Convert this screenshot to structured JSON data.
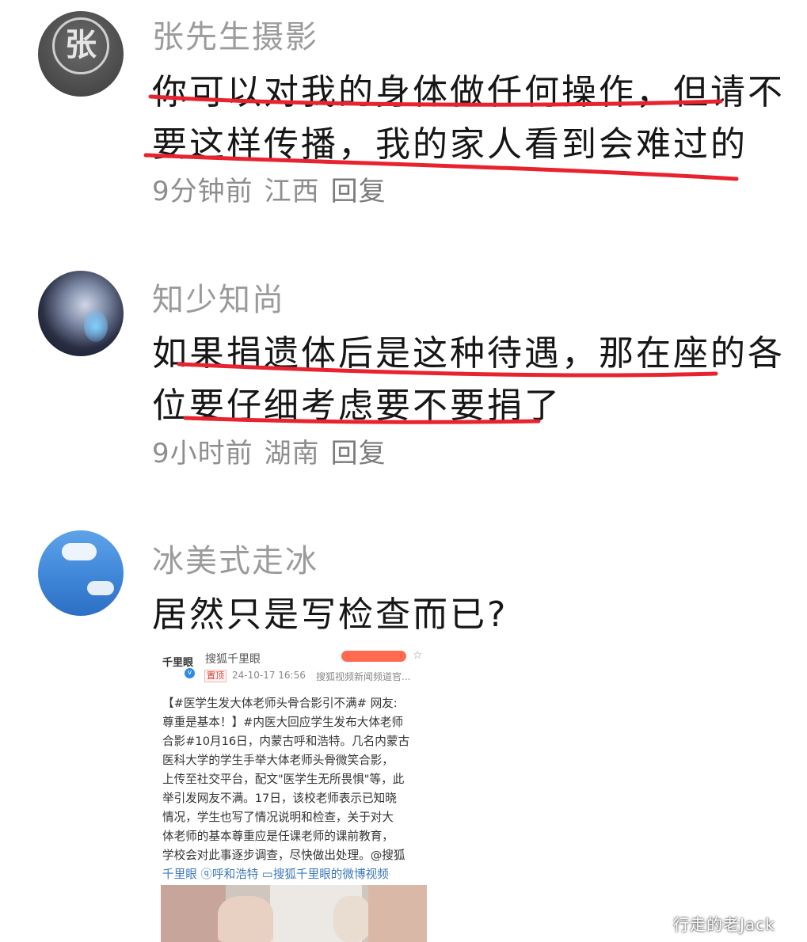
{
  "comments": [
    {
      "username": "张先生摄影",
      "avatar_text": "张",
      "lines": [
        "你可以对我的身体做任何操作，但请不",
        "要这样传播，我的家人看到会难过的"
      ],
      "time": "9分钟前",
      "location": "江西",
      "reply_label": "回复"
    },
    {
      "username": "知少知尚",
      "lines": [
        "如果捐遗体后是这种待遇，那在座的各",
        "位要仔细考虑要不要捐了"
      ],
      "time": "9小时前",
      "location": "湖南",
      "reply_label": "回复"
    },
    {
      "username": "冰美式走冰",
      "lines": [
        "居然只是写检查而已?"
      ]
    }
  ],
  "embed": {
    "logo": "千里眼",
    "source": "搜狐千里眼",
    "tag": "置顶",
    "date": "24-10-17 16:56",
    "origin": "搜狐视频新闻频道官...",
    "body_lines": [
      "【#医学生发大体老师头骨合影引不满# 网友:",
      "尊重是基本！】#内医大回应学生发布大体老师",
      "合影#10月16日，内蒙古呼和浩特。几名内蒙古",
      "医科大学的学生手举大体老师头骨微笑合影，",
      "上传至社交平台，配文\"医学生无所畏惧\"等，此",
      "举引发网友不满。17日，该校老师表示已知晓",
      "情况，学生也写了情况说明和检查，关于对大",
      "体老师的基本尊重应是任课老师的课前教育，",
      "学校会对此事逐步调查，尽快做出处理。@搜狐",
      "千里眼 ⓠ呼和浩特 ▭搜狐千里眼的微博视频"
    ]
  },
  "watermark": "行走的老Jack",
  "colors": {
    "underline": "#e8232f",
    "username": "#9b9b9b",
    "meta": "#8e8e8e",
    "text": "#161616"
  }
}
